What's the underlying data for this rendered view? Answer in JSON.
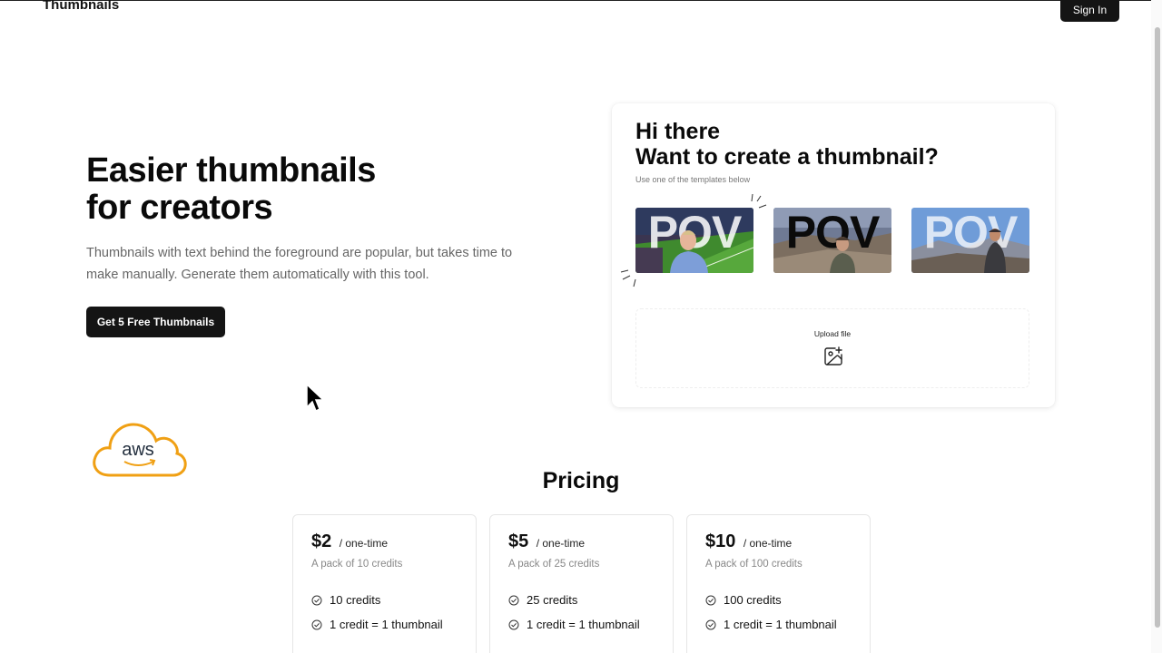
{
  "header": {
    "brand": "Thumbnails",
    "sign_in_label": "Sign In"
  },
  "hero": {
    "title_line1": "Easier thumbnails",
    "title_line2": "for creators",
    "subtitle_line1": "Thumbnails with text behind the foreground are popular, but takes time to",
    "subtitle_line2": "make manually. Generate them automatically with this tool.",
    "cta_label": "Get 5 Free Thumbnails"
  },
  "card": {
    "title_line1": "Hi there",
    "title_line2": "Want to create a thumbnail?",
    "subtitle": "Use one of the templates below",
    "templates": [
      {
        "text": "POV",
        "scene": "stadium",
        "text_color": "rgba(255,255,255,0.85)"
      },
      {
        "text": "POV",
        "scene": "rocky hillside",
        "text_color": "#0b0b0b"
      },
      {
        "text": "POV",
        "scene": "mountain summit",
        "text_color": "rgba(255,255,255,0.75)"
      }
    ],
    "upload_label": "Upload file",
    "upload_icon": "image-plus-icon"
  },
  "logos": {
    "aws_text": "aws"
  },
  "pricing": {
    "title": "Pricing",
    "plans": [
      {
        "price": "$2",
        "period": "/ one-time",
        "description": "A pack of 10 credits",
        "features": [
          "10 credits",
          "1 credit = 1 thumbnail"
        ]
      },
      {
        "price": "$5",
        "period": "/ one-time",
        "description": "A pack of 25 credits",
        "features": [
          "25 credits",
          "1 credit = 1 thumbnail"
        ]
      },
      {
        "price": "$10",
        "period": "/ one-time",
        "description": "A pack of 100 credits",
        "features": [
          "100 credits",
          "1 credit = 1 thumbnail"
        ]
      }
    ]
  },
  "colors": {
    "button_bg": "#141414",
    "aws_orange": "#f0a014"
  }
}
